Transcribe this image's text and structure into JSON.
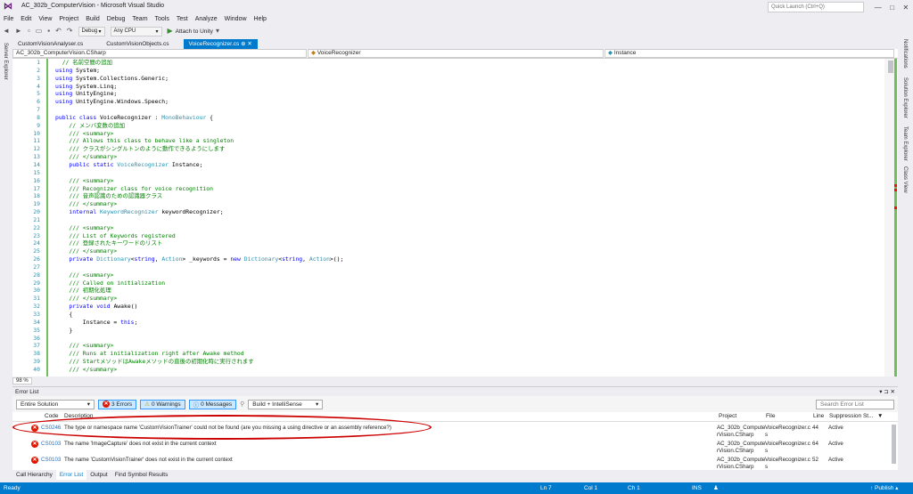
{
  "window": {
    "title": "AC_302b_ComputerVision - Microsoft Visual Studio",
    "quick_launch_placeholder": "Quick Launch (Ctrl+Q)",
    "controls": [
      "—",
      "□",
      "✕"
    ]
  },
  "menu": [
    "File",
    "Edit",
    "View",
    "Project",
    "Build",
    "Debug",
    "Team",
    "Tools",
    "Test",
    "Analyze",
    "Window",
    "Help"
  ],
  "toolbar": {
    "config": "Debug",
    "platform": "Any CPU",
    "attach": "Attach to Unity"
  },
  "left_rail": [
    "Server Explorer"
  ],
  "right_rail": [
    "Notifications",
    "Solution Explorer",
    "Team Explorer",
    "Class View"
  ],
  "doc_tabs": [
    {
      "label": "CustomVisionAnalyser.cs",
      "active": false
    },
    {
      "label": "CustomVisionObjects.cs",
      "active": false
    },
    {
      "label": "VoiceRecognizer.cs",
      "active": true
    }
  ],
  "nav": {
    "project": "AC_302b_ComputerVision.CSharp",
    "type": "VoiceRecognizer",
    "member": "Instance"
  },
  "code_lines": [
    {
      "n": "1",
      "t": "  // 名前空間の追加",
      "c": "cm"
    },
    {
      "n": "2",
      "t": "using System;",
      "c": "using"
    },
    {
      "n": "3",
      "t": "using System.Collections.Generic;",
      "c": "using"
    },
    {
      "n": "4",
      "t": "using System.Linq;",
      "c": "using"
    },
    {
      "n": "5",
      "t": "using UnityEngine;",
      "c": "using"
    },
    {
      "n": "6",
      "t": "using UnityEngine.Windows.Speech;",
      "c": "using"
    },
    {
      "n": "7",
      "t": "",
      "c": "pl"
    },
    {
      "n": "8",
      "t": "public class VoiceRecognizer : MonoBehaviour {",
      "c": "class"
    },
    {
      "n": "9",
      "t": "    // メンバ変数の追加",
      "c": "cm"
    },
    {
      "n": "10",
      "t": "    /// <summary>",
      "c": "cm"
    },
    {
      "n": "11",
      "t": "    /// Allows this class to behave like a singleton",
      "c": "cm"
    },
    {
      "n": "12",
      "t": "    /// クラスがシングルトンのように動作できるようにします",
      "c": "cm"
    },
    {
      "n": "13",
      "t": "    /// </summary>",
      "c": "cm"
    },
    {
      "n": "14",
      "t": "    public static VoiceRecognizer Instance;",
      "c": "decl"
    },
    {
      "n": "15",
      "t": "",
      "c": "pl"
    },
    {
      "n": "16",
      "t": "    /// <summary>",
      "c": "cm"
    },
    {
      "n": "17",
      "t": "    /// Recognizer class for voice recognition",
      "c": "cm"
    },
    {
      "n": "18",
      "t": "    /// 音声認識のための認識器クラス",
      "c": "cm"
    },
    {
      "n": "19",
      "t": "    /// </summary>",
      "c": "cm"
    },
    {
      "n": "20",
      "t": "    internal KeywordRecognizer keywordRecognizer;",
      "c": "decl"
    },
    {
      "n": "21",
      "t": "",
      "c": "pl"
    },
    {
      "n": "22",
      "t": "    /// <summary>",
      "c": "cm"
    },
    {
      "n": "23",
      "t": "    /// List of Keywords registered",
      "c": "cm"
    },
    {
      "n": "24",
      "t": "    /// 登録されたキーワードのリスト",
      "c": "cm"
    },
    {
      "n": "25",
      "t": "    /// </summary>",
      "c": "cm"
    },
    {
      "n": "26",
      "t": "    private Dictionary<string, Action> _keywords = new Dictionary<string, Action>();",
      "c": "decl"
    },
    {
      "n": "27",
      "t": "",
      "c": "pl"
    },
    {
      "n": "28",
      "t": "    /// <summary>",
      "c": "cm"
    },
    {
      "n": "29",
      "t": "    /// Called on initialization",
      "c": "cm"
    },
    {
      "n": "30",
      "t": "    /// 初期化処理",
      "c": "cm"
    },
    {
      "n": "31",
      "t": "    /// </summary>",
      "c": "cm"
    },
    {
      "n": "32",
      "t": "    private void Awake()",
      "c": "decl"
    },
    {
      "n": "33",
      "t": "    {",
      "c": "pl"
    },
    {
      "n": "34",
      "t": "        Instance = this;",
      "c": "stmt"
    },
    {
      "n": "35",
      "t": "    }",
      "c": "pl"
    },
    {
      "n": "36",
      "t": "",
      "c": "pl"
    },
    {
      "n": "37",
      "t": "    /// <summary>",
      "c": "cm"
    },
    {
      "n": "38",
      "t": "    /// Runs at initialization right after Awake method",
      "c": "cm"
    },
    {
      "n": "39",
      "t": "    /// StartメソッドはAwakeメソッドの直後の初期化時に実行されます",
      "c": "cm"
    },
    {
      "n": "40",
      "t": "    /// </summary>",
      "c": "cm"
    }
  ],
  "zoom": "98 %",
  "error_list": {
    "title": "Error List",
    "scope": "Entire Solution",
    "errors_btn": "3 Errors",
    "warnings_btn": "0 Warnings",
    "messages_btn": "0 Messages",
    "build_filter": "Build + IntelliSense",
    "search_placeholder": "Search Error List",
    "columns": [
      "Code",
      "Description",
      "Project",
      "File",
      "Line",
      "Suppression St..."
    ],
    "rows": [
      {
        "code": "CS0246",
        "desc": "The type or namespace name 'CustomVisionTrainer' could not be found (are you missing a using directive or an assembly reference?)",
        "project1": "AC_302b_Compute",
        "project2": "rVision.CSharp",
        "file1": "VoiceRecognizer.c",
        "file2": "s",
        "line": "44",
        "supp": "Active"
      },
      {
        "code": "CS0103",
        "desc": "The name 'ImageCapture' does not exist in the current context",
        "project1": "AC_302b_Compute",
        "project2": "rVision.CSharp",
        "file1": "VoiceRecognizer.c",
        "file2": "s",
        "line": "64",
        "supp": "Active"
      },
      {
        "code": "CS0103",
        "desc": "The name 'CustomVisionTrainer' does not exist in the current context",
        "project1": "AC_302b_Compute",
        "project2": "rVision.CSharp",
        "file1": "VoiceRecognizer.c",
        "file2": "s",
        "line": "52",
        "supp": "Active"
      }
    ]
  },
  "bottom_tabs": [
    {
      "label": "Call Hierarchy",
      "active": false
    },
    {
      "label": "Error List",
      "active": true
    },
    {
      "label": "Output",
      "active": false
    },
    {
      "label": "Find Symbol Results",
      "active": false
    }
  ],
  "status": {
    "ready": "Ready",
    "ln": "Ln 7",
    "col": "Col 1",
    "ch": "Ch 1",
    "ins": "INS",
    "publish": "↑ Publish ▴"
  },
  "colors": {
    "accent": "#007acc",
    "comment": "#008000",
    "keyword": "#0000ff",
    "type": "#2b91af",
    "error": "#e51400",
    "annotation": "#cc0000"
  }
}
